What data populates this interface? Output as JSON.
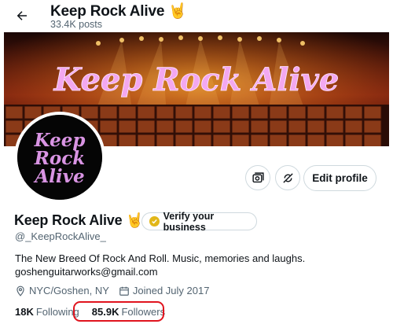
{
  "header": {
    "title": "Keep Rock Alive",
    "title_emoji": "🤘",
    "posts": "33.4K posts"
  },
  "banner": {
    "text": "Keep Rock Alive"
  },
  "avatar": {
    "lines": [
      "Keep",
      "Rock",
      "Alive"
    ]
  },
  "actions": {
    "edit_label": "Edit profile"
  },
  "profile": {
    "name": "Keep Rock Alive",
    "name_emoji": "🤘",
    "verify_label": "Verify your business",
    "handle": "@_KeepRockAlive_",
    "bio_line1": "The New Breed Of Rock And Roll. Music, memories and laughs.",
    "bio_line2": "goshenguitarworks@gmail.com",
    "location": "NYC/Goshen, NY",
    "joined": "Joined July 2017"
  },
  "stats": {
    "following_count": "18K",
    "following_label": "Following",
    "followers_count": "85.9K",
    "followers_label": "Followers"
  },
  "colors": {
    "accent_red": "#e0141e",
    "secondary_text": "#536471",
    "banner_text": "#f3a8f0",
    "avatar_text": "#d994e3"
  }
}
